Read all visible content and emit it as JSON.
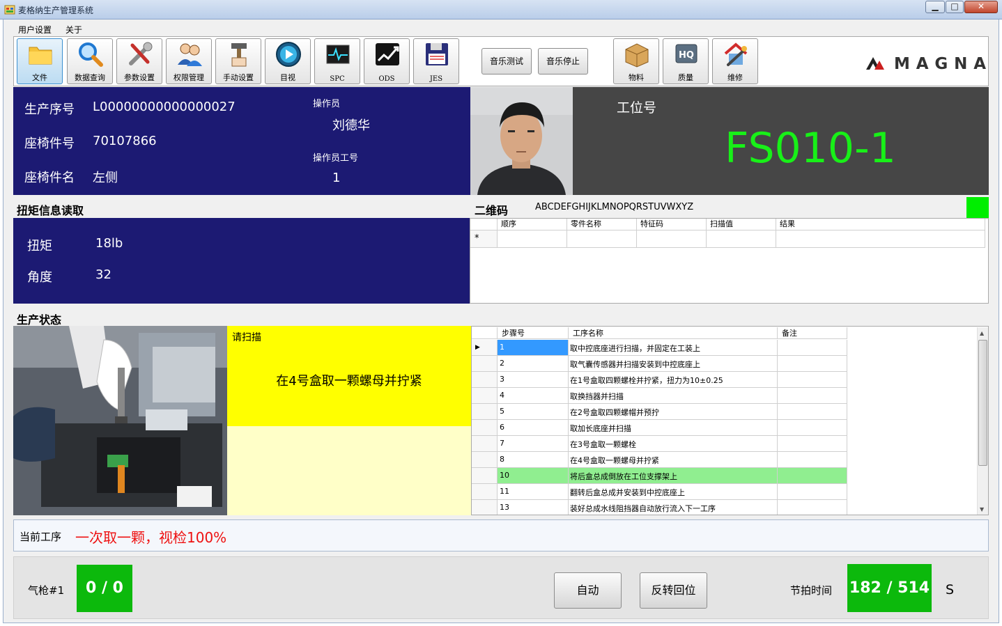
{
  "window": {
    "title": "麦格纳生产管理系统",
    "min_glyph": "▁",
    "max_glyph": "□",
    "close_glyph": "✕"
  },
  "menu": {
    "user_settings": "用户设置",
    "about": "关于"
  },
  "toolbar": {
    "file": "文件",
    "data_query": "数据查询",
    "param_settings": "参数设置",
    "permission": "权限管理",
    "manual_settings": "手动设置",
    "visual": "目视",
    "spc": "SPC",
    "ods": "ODS",
    "jes": "JES",
    "music_test": "音乐测试",
    "music_stop": "音乐停止",
    "material": "物料",
    "quality": "质量",
    "repair": "维修",
    "logo": "MAGNA",
    "quality_icon_text": "HQ"
  },
  "info": {
    "serial_label": "生产序号",
    "serial_value": "L00000000000000027",
    "part_no_label": "座椅件号",
    "part_no_value": "70107866",
    "part_name_label": "座椅件名",
    "part_name_value": "左侧",
    "operator_label": "操作员",
    "operator_value": "刘德华",
    "operator_id_label": "操作员工号",
    "operator_id_value": "1",
    "station_label": "工位号",
    "station_value": "FS010-1"
  },
  "torque": {
    "title": "扭矩信息读取",
    "torque_label": "扭矩",
    "torque_value": "18lb",
    "angle_label": "角度",
    "angle_value": "32"
  },
  "qr": {
    "title": "二维码",
    "value": "ABCDEFGHIJKLMNOPQRSTUVWXYZ",
    "indicator_color": "#00ee00",
    "columns": [
      "顺序",
      "零件名称",
      "特征码",
      "扫描值",
      "结果"
    ],
    "new_row_marker": "*"
  },
  "production": {
    "title": "生产状态",
    "scan_label": "请扫描",
    "instruction": "在4号盒取一颗螺母并拧紧",
    "steps_columns": [
      "步骤号",
      "工序名称",
      "备注"
    ],
    "current_row_marker": "▶",
    "steps": [
      {
        "no": "1",
        "name": "取中控底座进行扫描，并固定在工装上",
        "note": ""
      },
      {
        "no": "2",
        "name": "取气囊传感器并扫描安装到中控底座上",
        "note": ""
      },
      {
        "no": "3",
        "name": "在1号盒取四颗螺栓并拧紧，扭力为10±0.25",
        "note": ""
      },
      {
        "no": "4",
        "name": "取换挡器并扫描",
        "note": ""
      },
      {
        "no": "5",
        "name": "在2号盒取四颗螺帽并预拧",
        "note": ""
      },
      {
        "no": "6",
        "name": "取加长底座并扫描",
        "note": ""
      },
      {
        "no": "7",
        "name": "在3号盒取一颗螺栓",
        "note": ""
      },
      {
        "no": "8",
        "name": "在4号盒取一颗螺母并拧紧",
        "note": ""
      },
      {
        "no": "10",
        "name": "将后盒总成倒放在工位支撑架上",
        "note": ""
      },
      {
        "no": "11",
        "name": "翻转后盒总成并安装到中控底座上",
        "note": ""
      },
      {
        "no": "13",
        "name": "装好总成水线阻挡器自动放行流入下一工序",
        "note": ""
      }
    ],
    "highlight_row_color": "#90ee90"
  },
  "current": {
    "label": "当前工序",
    "value": "一次取一颗，视检100%"
  },
  "bottom": {
    "gun_label": "气枪#1",
    "gun_value": "0 / 0",
    "auto_button": "自动",
    "reverse_button": "反转回位",
    "takt_label": "节拍时间",
    "takt_value": "182 / 514",
    "takt_unit": "S"
  }
}
